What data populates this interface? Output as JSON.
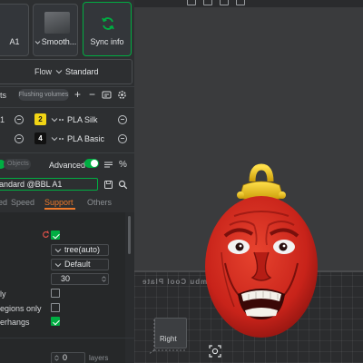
{
  "printer": {
    "label": "A1"
  },
  "plate": {
    "label": "Smooth..."
  },
  "sync": {
    "label": "Sync info"
  },
  "flow": {
    "label": "Flow",
    "value": "Standard"
  },
  "filaments": {
    "header_label": "ts",
    "flush_badge": "Flushing volumes",
    "rows": [
      {
        "slot": "2",
        "slot_color": "#f2d515",
        "name": "PLA Silk"
      },
      {
        "slot": "4",
        "slot_color": "#111111",
        "name": "PLA Basic"
      }
    ]
  },
  "settings_toggle": {
    "objects_label": "Objects",
    "advanced_label": "Advanced",
    "advanced_on": true
  },
  "process_profile": {
    "value": "andard @BBL A1"
  },
  "tabs": [
    {
      "label": "ed",
      "active": false
    },
    {
      "label": "Speed",
      "active": false
    },
    {
      "label": "Support",
      "active": true
    },
    {
      "label": "Others",
      "active": false
    }
  ],
  "support": {
    "type_value": "tree(auto)",
    "style_value": "Default",
    "threshold_value": "30",
    "options": [
      {
        "label": "ly",
        "checked": false
      },
      {
        "label": "egions only",
        "checked": false
      },
      {
        "label": "erhangs",
        "checked": true
      }
    ],
    "layers_value": "0",
    "layers_unit": "layers"
  },
  "viewport": {
    "bed_text": "Bambu Cool Plate",
    "view_label": "Right"
  },
  "colors": {
    "accent": "#00ae42",
    "tab_active": "#f07a2a",
    "model_red": "#d42a1c",
    "model_gold": "#f2c80f"
  }
}
